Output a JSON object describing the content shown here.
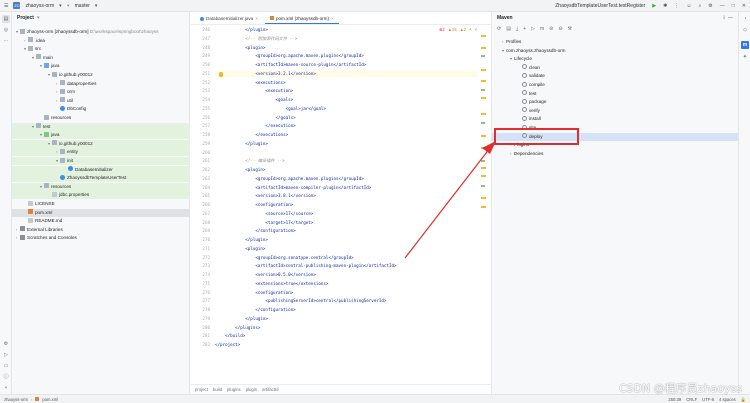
{
  "titlebar": {
    "project_badge": "ZO",
    "project_name": "zhaoyss-orm",
    "branch": "master",
    "run_config": "ZhaoysdbTemplateUserTest.testRegister",
    "icons": [
      "hamburger-icon",
      "run-icon",
      "debug-icon",
      "more-icon",
      "user-icon",
      "search-icon",
      "settings-icon",
      "minimize-icon",
      "maximize-icon",
      "close-icon"
    ]
  },
  "project_panel": {
    "title": "Project",
    "tree": [
      {
        "label": "zhaoyss-orm [zhaoyssdb-orm]",
        "suffix": "D:\\workspace\\springboot\\zhaoyss",
        "depth": 0,
        "icon": "folder",
        "arrow": "▾"
      },
      {
        "label": ".idea",
        "depth": 1,
        "icon": "folder",
        "arrow": "›"
      },
      {
        "label": "src",
        "depth": 1,
        "icon": "folder",
        "arrow": "▾"
      },
      {
        "label": "main",
        "depth": 2,
        "icon": "folder",
        "arrow": "▾"
      },
      {
        "label": "java",
        "depth": 3,
        "icon": "src",
        "arrow": "▾"
      },
      {
        "label": "io.github.y00012",
        "depth": 4,
        "icon": "folder",
        "arrow": "▾"
      },
      {
        "label": "dataproperties",
        "depth": 5,
        "icon": "folder",
        "arrow": "›"
      },
      {
        "label": "orm",
        "depth": 5,
        "icon": "folder",
        "arrow": "›"
      },
      {
        "label": "util",
        "depth": 5,
        "icon": "folder",
        "arrow": "›"
      },
      {
        "label": "DbConfig",
        "depth": 5,
        "icon": "java",
        "arrow": ""
      },
      {
        "label": "resources",
        "depth": 3,
        "icon": "folder",
        "arrow": ""
      },
      {
        "label": "test",
        "depth": 2,
        "icon": "folder",
        "arrow": "▾",
        "hl": "green"
      },
      {
        "label": "java",
        "depth": 3,
        "icon": "test",
        "arrow": "▾",
        "hl": "green"
      },
      {
        "label": "io.github.y00012",
        "depth": 4,
        "icon": "folder",
        "arrow": "▾",
        "hl": "green"
      },
      {
        "label": "entity",
        "depth": 5,
        "icon": "folder",
        "arrow": "›",
        "hl": "green"
      },
      {
        "label": "init",
        "depth": 5,
        "icon": "folder",
        "arrow": "▾",
        "hl": "green"
      },
      {
        "label": "DatabaseInitializer",
        "depth": 6,
        "icon": "java",
        "arrow": "",
        "hl": "green"
      },
      {
        "label": "ZhaoyssdbTemplateUserTest",
        "depth": 5,
        "icon": "java",
        "arrow": "",
        "hl": "green"
      },
      {
        "label": "resources",
        "depth": 3,
        "icon": "folder",
        "arrow": "▾",
        "hl": "green"
      },
      {
        "label": "jdbc.properties",
        "depth": 4,
        "icon": "file",
        "arrow": "",
        "hl": "green"
      },
      {
        "label": "LICENSE",
        "depth": 1,
        "icon": "file",
        "arrow": ""
      },
      {
        "label": "pom.xml",
        "depth": 1,
        "icon": "xml",
        "arrow": "",
        "hl": "sel"
      },
      {
        "label": "README.md",
        "depth": 1,
        "icon": "file",
        "arrow": ""
      },
      {
        "label": "External Libraries",
        "depth": 0,
        "icon": "lib",
        "arrow": "›"
      },
      {
        "label": "Scratches and Consoles",
        "depth": 0,
        "icon": "lib",
        "arrow": "›"
      }
    ]
  },
  "editor": {
    "tabs": [
      {
        "label": "DatabaseInitializer.java",
        "active": false
      },
      {
        "label": "pom.xml (zhaoyssdb-orm)",
        "active": true
      }
    ],
    "inspections": {
      "errors": "2",
      "warnings": "16",
      "weak": "2"
    },
    "lines": [
      {
        "n": "246",
        "t": "            </plugin>"
      },
      {
        "n": "247",
        "t": "            <!-- 附加源代码文件 -->",
        "cmt": true
      },
      {
        "n": "248",
        "t": "            <plugin>"
      },
      {
        "n": "249",
        "t": "                <groupId>org.apache.maven.plugins</groupId>"
      },
      {
        "n": "250",
        "t": "                <artifactId>maven-source-plugin</artifactId>"
      },
      {
        "n": "251",
        "t": "                <version>3.2.1</version>"
      },
      {
        "n": "252",
        "t": "                <executions>"
      },
      {
        "n": "253",
        "t": "                    <execution>"
      },
      {
        "n": "254",
        "t": "                        <goals>"
      },
      {
        "n": "255",
        "t": "                            <goal>jar</goal>"
      },
      {
        "n": "256",
        "t": "                        </goals>"
      },
      {
        "n": "257",
        "t": "                    </execution>"
      },
      {
        "n": "258",
        "t": "                </executions>"
      },
      {
        "n": "259",
        "t": "            </plugin>"
      },
      {
        "n": "260",
        "t": ""
      },
      {
        "n": "261",
        "t": "            <!-- 编译插件 -->",
        "cmt": true
      },
      {
        "n": "262",
        "t": "            <plugin>"
      },
      {
        "n": "263",
        "t": "                <groupId>org.apache.maven.plugins</groupId>"
      },
      {
        "n": "264",
        "t": "                <artifactId>maven-compiler-plugin</artifactId>"
      },
      {
        "n": "265",
        "t": "                <version>3.8.1</version>"
      },
      {
        "n": "266",
        "t": "                <configuration>"
      },
      {
        "n": "267",
        "t": "                    <source>17</source>"
      },
      {
        "n": "268",
        "t": "                    <target>17</target>"
      },
      {
        "n": "269",
        "t": "                </configuration>"
      },
      {
        "n": "270",
        "t": "            </plugin>"
      },
      {
        "n": "271",
        "t": "            <plugin>"
      },
      {
        "n": "272",
        "t": "                <groupId>org.sonatype.central</groupId>"
      },
      {
        "n": "273",
        "t": "                <artifactId>central-publishing-maven-plugin</artifactId>"
      },
      {
        "n": "274",
        "t": "                <version>0.5.0</version>"
      },
      {
        "n": "275",
        "t": "                <extensions>true</extensions>"
      },
      {
        "n": "276",
        "t": "                <configuration>"
      },
      {
        "n": "277",
        "t": "                    <publishingServerId>central</publishingServerId>"
      },
      {
        "n": "278",
        "t": "                </configuration>"
      },
      {
        "n": "279",
        "t": "            </plugin>"
      },
      {
        "n": "280",
        "t": "        </plugins>"
      },
      {
        "n": "281",
        "t": "    </build>"
      },
      {
        "n": "282",
        "t": "</project>"
      }
    ],
    "breadcrumbs": [
      "project",
      "build",
      "plugins",
      "plugin",
      "artifactId"
    ]
  },
  "maven_panel": {
    "title": "Maven",
    "tree": [
      {
        "label": "Profiles",
        "depth": 1,
        "arrow": "›",
        "icon": "folder"
      },
      {
        "label": "com.zhaoyss.zhaoyssdb-orm",
        "depth": 1,
        "arrow": "▾",
        "icon": "module"
      },
      {
        "label": "Lifecycle",
        "depth": 2,
        "arrow": "▾",
        "icon": "folder"
      },
      {
        "label": "clean",
        "depth": 3,
        "arrow": "",
        "icon": "gear"
      },
      {
        "label": "validate",
        "depth": 3,
        "arrow": "",
        "icon": "gear"
      },
      {
        "label": "compile",
        "depth": 3,
        "arrow": "",
        "icon": "gear"
      },
      {
        "label": "test",
        "depth": 3,
        "arrow": "",
        "icon": "gear"
      },
      {
        "label": "package",
        "depth": 3,
        "arrow": "",
        "icon": "gear"
      },
      {
        "label": "verify",
        "depth": 3,
        "arrow": "",
        "icon": "gear"
      },
      {
        "label": "install",
        "depth": 3,
        "arrow": "",
        "icon": "gear"
      },
      {
        "label": "site",
        "depth": 3,
        "arrow": "",
        "icon": "gear"
      },
      {
        "label": "deploy",
        "depth": 3,
        "arrow": "",
        "icon": "gear",
        "selected": true
      },
      {
        "label": "Plugins",
        "depth": 2,
        "arrow": "›",
        "icon": "folder"
      },
      {
        "label": "Dependencies",
        "depth": 2,
        "arrow": "›",
        "icon": "folder"
      }
    ]
  },
  "statusbar": {
    "path": [
      "zhaoyss-orm",
      "pom.xml"
    ],
    "position": "250:39",
    "line_sep": "CRLF",
    "encoding": "UTF-8",
    "indent": "4 spaces"
  },
  "watermark": "CSDN @程序员zhaoyss",
  "annotation_color": "#e02d2d"
}
